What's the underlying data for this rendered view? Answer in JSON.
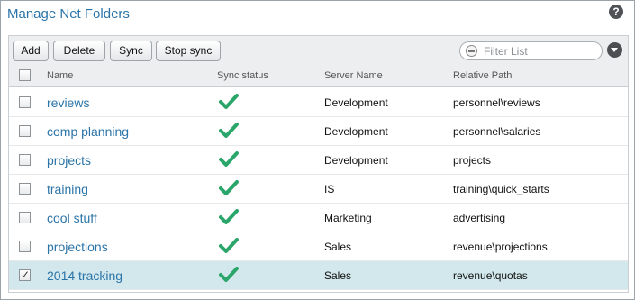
{
  "window": {
    "title": "Manage Net Folders",
    "help_glyph": "?"
  },
  "toolbar": {
    "buttons": [
      {
        "id": "add",
        "label": "Add"
      },
      {
        "id": "delete",
        "label": "Delete"
      },
      {
        "id": "sync",
        "label": "Sync"
      },
      {
        "id": "stop_sync",
        "label": "Stop sync"
      }
    ],
    "filter_placeholder": "Filter List",
    "filter_icon": "filter-icon",
    "menu_icon": "chevron-down-icon"
  },
  "table": {
    "columns": [
      "Name",
      "Sync status",
      "Server Name",
      "Relative Path"
    ],
    "rows": [
      {
        "name": "reviews",
        "sync_status": "ok",
        "server": "Development",
        "path": "personnel\\reviews",
        "checked": false
      },
      {
        "name": "comp planning",
        "sync_status": "ok",
        "server": "Development",
        "path": "personnel\\salaries",
        "checked": false
      },
      {
        "name": "projects",
        "sync_status": "ok",
        "server": "Development",
        "path": "projects",
        "checked": false
      },
      {
        "name": "training",
        "sync_status": "ok",
        "server": "IS",
        "path": "training\\quick_starts",
        "checked": false
      },
      {
        "name": "cool stuff",
        "sync_status": "ok",
        "server": "Marketing",
        "path": "advertising",
        "checked": false
      },
      {
        "name": "projections",
        "sync_status": "ok",
        "server": "Sales",
        "path": "revenue\\projections",
        "checked": false
      },
      {
        "name": "2014 tracking",
        "sync_status": "ok",
        "server": "Sales",
        "path": "revenue\\quotas",
        "checked": true
      }
    ]
  },
  "colors": {
    "link": "#2b74a8",
    "sync_ok": "#2aa66a",
    "selected_row": "#d2e8ec",
    "toolbar_bg": "#eceeef"
  }
}
